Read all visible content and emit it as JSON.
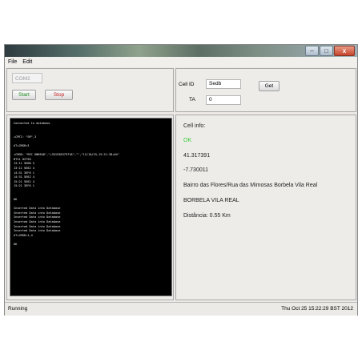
{
  "window": {
    "controls": {
      "minimize": "–",
      "maximize": "□",
      "close": "x"
    }
  },
  "menu": {
    "file": "File",
    "edit": "Edit"
  },
  "connection": {
    "port_value": "COM2",
    "start_label": "Start",
    "stop_label": "Stop",
    "start_color": "#1e8c1e",
    "stop_color": "#c81e1e"
  },
  "cell_query": {
    "cell_id_label": "Cell ID",
    "cell_id_value": "Sedb",
    "ta_label": "TA",
    "ta_value": "0",
    "get_label": "Get"
  },
  "terminal": {
    "lines": [
      "Connected to database",
      "",
      "",
      "+CMTI: \"SM\",3",
      "",
      "AT+CMGR=3",
      "",
      "+CMGR: \"REC UNREAD\",\"+351938379718\",\"\",\"12/10/25,15:21:38+04\"",
      "BTS1 02796",
      "13:11 5EDB 5",
      "13:11 5E62 4",
      "14:31 3EF6 1",
      "14:31 5E62 4",
      "15:21 5E62 4",
      "15:21 3EF6 1",
      "",
      "",
      "OK",
      "",
      "Inserted Data into Database",
      "Inserted Data into Database",
      "Inserted Data into Database",
      "Inserted Data into Database",
      "Inserted Data into Database",
      "Inserted Data into Database",
      "AT+CMGD=1,4",
      "",
      "OK"
    ]
  },
  "cell_info": {
    "title": "Cell info:",
    "status": "OK",
    "status_color": "#33cc33",
    "latitude": "41.317391",
    "longitude": "-7.730011",
    "address": "Bairro das Flores/Rua das Mimosas Borbela Vila Real",
    "locality": "BORBELA VILA REAL",
    "distance": "Distância: 0.55 Km"
  },
  "status_bar": {
    "state": "Running",
    "datetime": "Thu Oct 25 15:22:29 BST 2012"
  }
}
